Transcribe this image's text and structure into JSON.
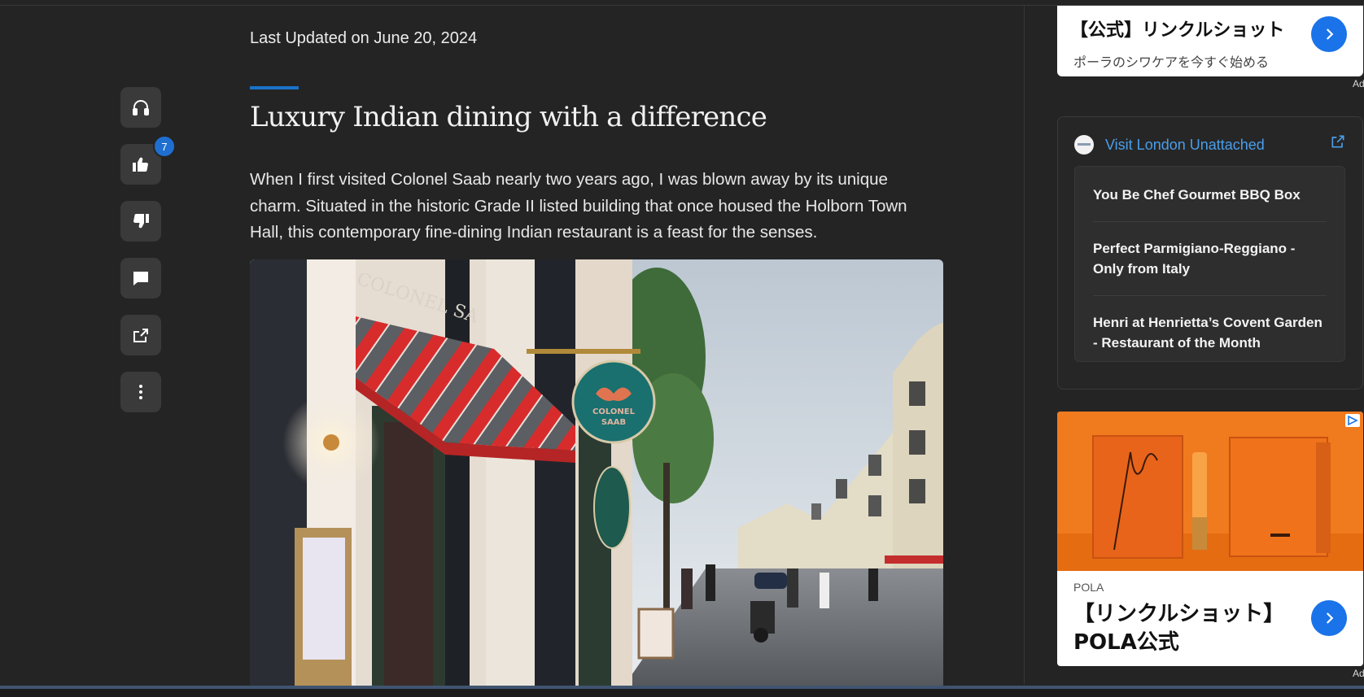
{
  "article": {
    "updated": "Last Updated on June 20, 2024",
    "headline": "Luxury Indian dining with a difference",
    "body": "When I first visited Colonel Saab nearly two years ago, I was blown away by its unique charm. Situated in the historic Grade II listed building that once housed the Holborn Town Hall, this contemporary fine-dining Indian restaurant is a feast for the senses.",
    "photo": {
      "sign_text_1": "COLONEL",
      "sign_text_2": "SAAB",
      "facade_text": "COLONEL SA"
    }
  },
  "rail": {
    "buttons": [
      {
        "name": "listen",
        "icon": "headphones-icon"
      },
      {
        "name": "like",
        "icon": "thumbs-up-icon",
        "count": "7"
      },
      {
        "name": "dislike",
        "icon": "thumbs-down-icon"
      },
      {
        "name": "comment",
        "icon": "comment-icon"
      },
      {
        "name": "share",
        "icon": "share-icon"
      },
      {
        "name": "more",
        "icon": "more-vertical-icon"
      }
    ]
  },
  "ads": {
    "top": {
      "title": "【公式】リンクルショット",
      "subtitle": "ポーラのシワケアを今すぐ始める",
      "label": "Ad"
    },
    "pola": {
      "brand": "POLA",
      "title": "【リンクルショット】POLA公式",
      "label": "Ad"
    }
  },
  "recommendations": {
    "source": "Visit London Unattached",
    "items": [
      "You Be Chef Gourmet BBQ Box",
      "Perfect Parmigiano-Reggiano - Only from Italy",
      "Henri at Henrietta’s Covent Garden - Restaurant of the Month"
    ]
  },
  "colors": {
    "background": "#242424",
    "accent": "#1a73c9",
    "link": "#4a9eea",
    "badge": "#1f6fd1"
  }
}
